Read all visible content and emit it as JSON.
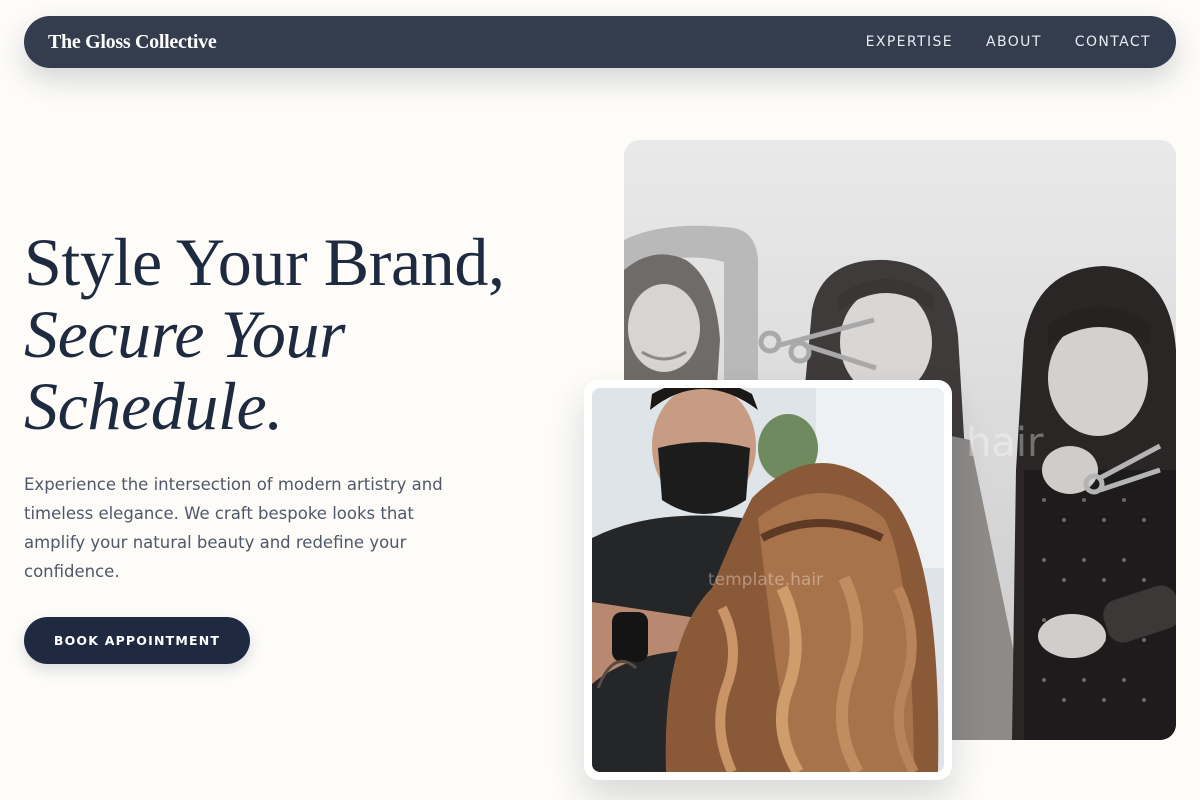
{
  "nav": {
    "brand": "The Gloss Collective",
    "links": [
      "EXPERTISE",
      "ABOUT",
      "CONTACT"
    ]
  },
  "hero": {
    "headline_line1": "Style Your Brand,",
    "headline_line2": "Secure Your",
    "headline_line3": "Schedule.",
    "description": "Experience the intersection of modern artistry and timeless elegance. We craft bespoke looks that amplify your natural beauty and redefine your confidence.",
    "cta_label": "BOOK APPOINTMENT"
  },
  "images": {
    "large_watermark": "hair",
    "small_watermark": "template.hair"
  },
  "colors": {
    "nav_background": "#333d4d",
    "page_background": "#fdfcf9",
    "heading": "#1e2a40",
    "body_text": "#4f5868",
    "cta_background": "#1f2a40"
  }
}
